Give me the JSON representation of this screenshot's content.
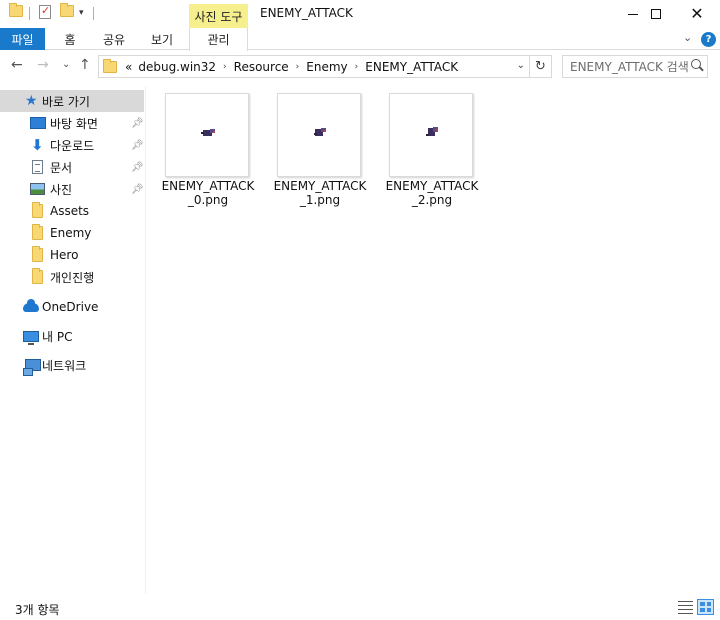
{
  "window": {
    "title": "ENEMY_ATTACK",
    "contextual_tab_group": "사진 도구"
  },
  "ribbon": {
    "tabs": [
      "파일",
      "홈",
      "공유",
      "보기",
      "관리"
    ]
  },
  "navigation": {
    "breadcrumb_prefix": "«",
    "breadcrumbs": [
      "debug.win32",
      "Resource",
      "Enemy",
      "ENEMY_ATTACK"
    ],
    "search_placeholder": "ENEMY_ATTACK 검색"
  },
  "sidebar": {
    "quick_access": "바로 가기",
    "pinned": [
      "바탕 화면",
      "다운로드",
      "문서",
      "사진"
    ],
    "folders": [
      "Assets",
      "Enemy",
      "Hero",
      "개인진행"
    ],
    "onedrive": "OneDrive",
    "this_pc": "내 PC",
    "network": "네트워크"
  },
  "files": [
    {
      "name": "ENEMY_ATTACK_0.png"
    },
    {
      "name": "ENEMY_ATTACK_1.png"
    },
    {
      "name": "ENEMY_ATTACK_2.png"
    }
  ],
  "status": {
    "item_count": "3개 항목"
  },
  "colors": {
    "accent": "#1979ca",
    "contextual_tab": "#f6ef8d",
    "selected_nav": "#d9d9d9",
    "folder": "#f8d775"
  },
  "icons": {
    "quick_access": "star-icon",
    "desktop": "desktop-icon",
    "downloads": "download-arrow-icon",
    "documents": "document-icon",
    "pictures": "pictures-icon",
    "folder": "folder-icon",
    "onedrive": "cloud-icon",
    "this_pc": "computer-icon",
    "network": "network-icon"
  }
}
